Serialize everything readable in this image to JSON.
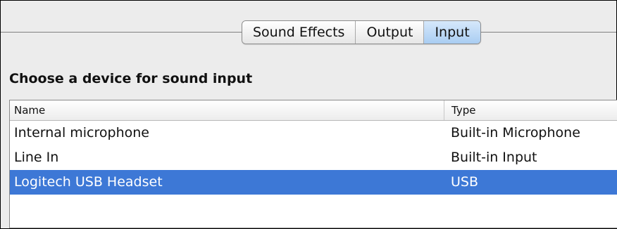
{
  "tabs": [
    {
      "label": "Sound Effects",
      "selected": false
    },
    {
      "label": "Output",
      "selected": false
    },
    {
      "label": "Input",
      "selected": true
    }
  ],
  "section_title": "Choose a device for sound input",
  "table": {
    "columns": {
      "name": "Name",
      "type": "Type"
    },
    "rows": [
      {
        "name": "Internal microphone",
        "type": "Built-in Microphone",
        "selected": false
      },
      {
        "name": "Line In",
        "type": "Built-in Input",
        "selected": false
      },
      {
        "name": "Logitech USB Headset",
        "type": "USB",
        "selected": true
      }
    ]
  },
  "colors": {
    "selection": "#3d78d6",
    "selected_tab": "#a9cdf2",
    "window_bg": "#ececec"
  }
}
